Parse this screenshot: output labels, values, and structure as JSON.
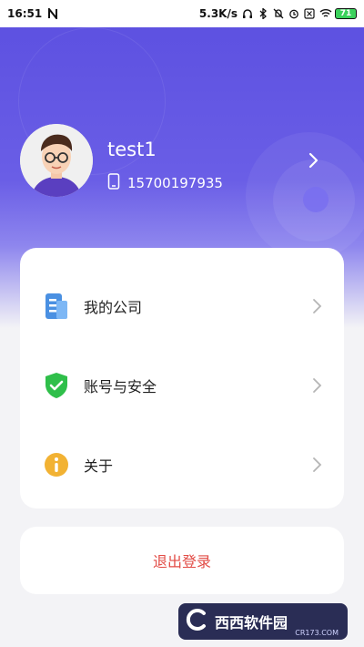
{
  "status_bar": {
    "time": "16:51",
    "speed": "5.3K/s",
    "battery": "71"
  },
  "profile": {
    "username": "test1",
    "phone": "15700197935"
  },
  "menu": {
    "items": [
      {
        "label": "我的公司",
        "icon": "building-icon",
        "color": "#4a90e2"
      },
      {
        "label": "账号与安全",
        "icon": "shield-check-icon",
        "color": "#2fbf4a"
      },
      {
        "label": "关于",
        "icon": "info-icon",
        "color": "#f2b233"
      }
    ]
  },
  "logout": {
    "label": "退出登录"
  },
  "watermark": {
    "text": "西西软件园",
    "sub": "CR173.COM"
  },
  "colors": {
    "header_purple": "#5b4fe0",
    "logout_red": "#e24b45"
  }
}
